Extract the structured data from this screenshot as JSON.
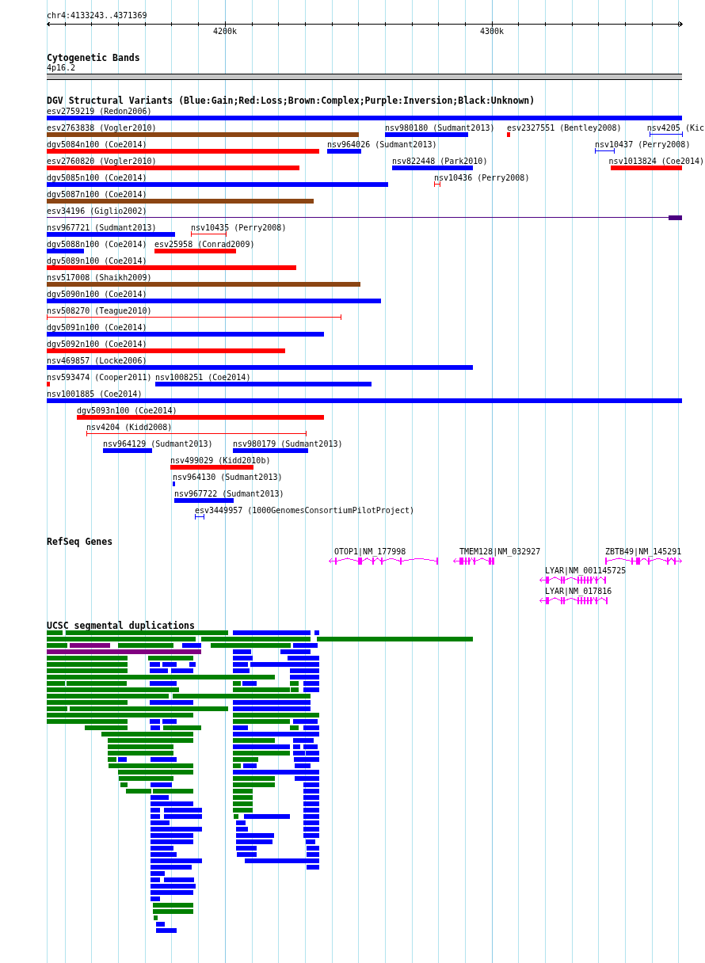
{
  "ruler": {
    "region": "chr4:4133243..4371369",
    "ticks": [
      "4200k",
      "4300k"
    ]
  },
  "cytogenetic_bands": {
    "title": "Cytogenetic Bands",
    "bands": [
      {
        "label": "4p16.2"
      }
    ]
  },
  "dgv_structural_variants": {
    "title": "DGV Structural Variants (Blue:Gain;Red:Loss;Brown:Complex;Purple:Inversion;Black:Unknown)",
    "variants": [
      {
        "label": "esv2759219 (Redon2006)",
        "kind": "bar",
        "color": "#0000ff"
      },
      {
        "label": "esv2763838 (Vogler2010)",
        "kind": "bar",
        "color": "#8b4513"
      },
      {
        "label": "nsv980180 (Sudmant2013)",
        "kind": "bar",
        "color": "#0000ff"
      },
      {
        "label": "esv2327551 (Bentley2008)",
        "kind": "bar",
        "color": "#ff0000"
      },
      {
        "label": "nsv4205 (Kic",
        "kind": "span",
        "color": "#0000ff"
      },
      {
        "label": "dgv5084n100 (Coe2014)",
        "kind": "bar",
        "color": "#ff0000"
      },
      {
        "label": "nsv964026 (Sudmant2013)",
        "kind": "bar",
        "color": "#0000ff"
      },
      {
        "label": "nsv10437 (Perry2008)",
        "kind": "span",
        "color": "#0000ff"
      },
      {
        "label": "esv2760820 (Vogler2010)",
        "kind": "bar",
        "color": "#ff0000"
      },
      {
        "label": "nsv822448 (Park2010)",
        "kind": "bar",
        "color": "#0000ff"
      },
      {
        "label": "nsv1013824 (Coe2014)",
        "kind": "bar",
        "color": "#ff0000"
      },
      {
        "label": "dgv5085n100 (Coe2014)",
        "kind": "bar",
        "color": "#0000ff"
      },
      {
        "label": "nsv10436 (Perry2008)",
        "kind": "span",
        "color": "#ff0000"
      },
      {
        "label": "dgv5087n100 (Coe2014)",
        "kind": "bar",
        "color": "#8b4513"
      },
      {
        "label": "esv34196 (Giglio2002)",
        "kind": "linked",
        "color": "#4b0082"
      },
      {
        "label": "nsv967721 (Sudmant2013)",
        "kind": "bar",
        "color": "#0000ff"
      },
      {
        "label": "nsv10435 (Perry2008)",
        "kind": "span",
        "color": "#ff0000"
      },
      {
        "label": "dgv5088n100 (Coe2014)",
        "kind": "bar",
        "color": "#0000ff"
      },
      {
        "label": "esv25958 (Conrad2009)",
        "kind": "bar",
        "color": "#ff0000"
      },
      {
        "label": "dgv5089n100 (Coe2014)",
        "kind": "bar",
        "color": "#ff0000"
      },
      {
        "label": "nsv517008 (Shaikh2009)",
        "kind": "bar",
        "color": "#8b4513"
      },
      {
        "label": "dgv5090n100 (Coe2014)",
        "kind": "bar",
        "color": "#0000ff"
      },
      {
        "label": "nsv508270 (Teague2010)",
        "kind": "span",
        "color": "#ff0000"
      },
      {
        "label": "dgv5091n100 (Coe2014)",
        "kind": "bar",
        "color": "#0000ff"
      },
      {
        "label": "dgv5092n100 (Coe2014)",
        "kind": "bar",
        "color": "#ff0000"
      },
      {
        "label": "nsv469857 (Locke2006)",
        "kind": "bar",
        "color": "#0000ff"
      },
      {
        "label": "nsv593474 (Cooper2011)",
        "kind": "bar",
        "color": "#ff0000"
      },
      {
        "label": "nsv1008251 (Coe2014)",
        "kind": "bar",
        "color": "#0000ff"
      },
      {
        "label": "nsv1001885 (Coe2014)",
        "kind": "bar",
        "color": "#0000ff"
      },
      {
        "label": "dgv5093n100 (Coe2014)",
        "kind": "bar",
        "color": "#ff0000"
      },
      {
        "label": "nsv4204 (Kidd2008)",
        "kind": "span",
        "color": "#ff0000"
      },
      {
        "label": "nsv964129 (Sudmant2013)",
        "kind": "bar",
        "color": "#0000ff"
      },
      {
        "label": "nsv980179 (Sudmant2013)",
        "kind": "bar",
        "color": "#0000ff"
      },
      {
        "label": "nsv499029 (Kidd2010b)",
        "kind": "bar",
        "color": "#ff0000"
      },
      {
        "label": "nsv964130 (Sudmant2013)",
        "kind": "bar",
        "color": "#0000ff"
      },
      {
        "label": "nsv967722 (Sudmant2013)",
        "kind": "bar",
        "color": "#0000ff"
      },
      {
        "label": "esv3449957 (1000GenomesConsortiumPilotProject)",
        "kind": "span",
        "color": "#0000ff"
      }
    ]
  },
  "refseq_genes": {
    "title": "RefSeq Genes",
    "genes": [
      {
        "label": "OTOP1|NM_177998",
        "forward": false
      },
      {
        "label": "TMEM128|NM_032927",
        "forward": false
      },
      {
        "label": "ZBTB49|NM_145291",
        "forward": true
      },
      {
        "label": "LYAR|NM_001145725",
        "forward": false
      },
      {
        "label": "LYAR|NM_017816",
        "forward": false
      }
    ]
  },
  "segmental_duplications": {
    "title": "UCSC segmental duplications"
  }
}
